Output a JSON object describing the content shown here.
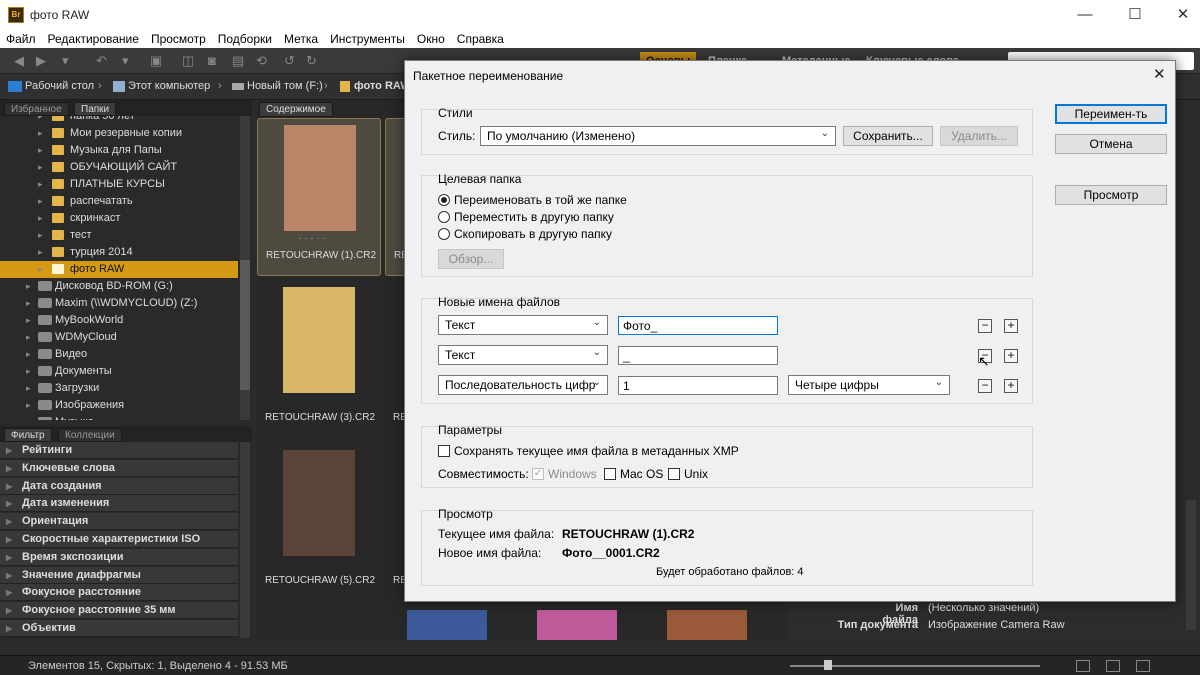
{
  "window": {
    "title": "фото RAW",
    "app_icon": "Br",
    "minimize": "—",
    "maximize": "☐",
    "close": "✕"
  },
  "menu": [
    "Файл",
    "Редактирование",
    "Просмотр",
    "Подборки",
    "Метка",
    "Инструменты",
    "Окно",
    "Справка"
  ],
  "path": [
    "Рабочий стол",
    "Этот компьютер",
    "Новый том (F:)",
    "фото RAW"
  ],
  "workspace_tabs": [
    "Основы",
    "Пленка",
    "Метаданные",
    "Ключевые слова"
  ],
  "left_panel": {
    "tabs": [
      "Избранное",
      "Папки"
    ],
    "folders": [
      {
        "label": "папка 50 лет",
        "type": "folder"
      },
      {
        "label": "Мои резервные копии",
        "type": "folder"
      },
      {
        "label": "Музыка для Папы",
        "type": "folder"
      },
      {
        "label": "ОБУЧАЮЩИЙ САЙТ",
        "type": "folder"
      },
      {
        "label": "ПЛАТНЫЕ КУРСЫ",
        "type": "folder"
      },
      {
        "label": "распечатать",
        "type": "folder"
      },
      {
        "label": "скринкаст",
        "type": "folder"
      },
      {
        "label": "тест",
        "type": "folder"
      },
      {
        "label": "турция 2014",
        "type": "folder"
      },
      {
        "label": "фото RAW",
        "type": "folder",
        "selected": true
      },
      {
        "label": "Дисковод BD-ROM (G:)",
        "type": "drive"
      },
      {
        "label": "Maxim (\\\\WDMYCLOUD) (Z:)",
        "type": "drive"
      },
      {
        "label": "MyBookWorld",
        "type": "drive"
      },
      {
        "label": "WDMyCloud",
        "type": "drive"
      },
      {
        "label": "Видео",
        "type": "drive"
      },
      {
        "label": "Документы",
        "type": "drive"
      },
      {
        "label": "Загрузки",
        "type": "drive"
      },
      {
        "label": "Изображения",
        "type": "drive"
      },
      {
        "label": "Музыка",
        "type": "drive"
      }
    ],
    "filter_tabs": [
      "Фильтр",
      "Коллекции"
    ],
    "filters": [
      "Рейтинги",
      "Ключевые слова",
      "Дата создания",
      "Дата изменения",
      "Ориентация",
      "Скоростные характеристики ISO",
      "Время экспозиции",
      "Значение диафрагмы",
      "Фокусное расстояние",
      "Фокусное расстояние 35 мм",
      "Объектив"
    ]
  },
  "content": {
    "tab": "Содержимое",
    "thumbnails": [
      {
        "caption": "RETOUCHRAW (1).CR2",
        "selected": true,
        "color": "#b98468"
      },
      {
        "caption": "RE",
        "selected": true,
        "color": "#555"
      },
      {
        "caption": "RETOUCHRAW (3).CR2",
        "selected": false,
        "color": "#d8b66a"
      },
      {
        "caption": "RE",
        "selected": false,
        "color": "#555"
      },
      {
        "caption": "RETOUCHRAW (5).CR2",
        "selected": false,
        "color": "#5a4438"
      },
      {
        "caption": "RE",
        "selected": false,
        "color": "#555"
      }
    ],
    "rating_dots": "· · · · ·"
  },
  "right_panel": {
    "meta": [
      {
        "key": "Имя файла",
        "value": "(Несколько значений)"
      },
      {
        "key": "Тип документа",
        "value": "Изображение Camera Raw"
      }
    ]
  },
  "status": {
    "text": "Элементов 15, Скрытых: 1, Выделено 4 - 91.53 МБ"
  },
  "dialog": {
    "title": "Пакетное переименование",
    "close": "✕",
    "buttons": {
      "rename": "Переимен-ть",
      "cancel": "Отмена",
      "preview": "Просмотр"
    },
    "styles": {
      "group_title": "Стили",
      "label": "Стиль:",
      "value": "По умолчанию (Изменено)",
      "save": "Сохранить...",
      "delete": "Удалить..."
    },
    "target": {
      "group_title": "Целевая папка",
      "options": [
        {
          "label": "Переименовать в той же папке",
          "checked": true
        },
        {
          "label": "Переместить в другую папку",
          "checked": false
        },
        {
          "label": "Скопировать в другую папку",
          "checked": false
        }
      ],
      "browse": "Обзор..."
    },
    "new_names": {
      "group_title": "Новые имена файлов",
      "rows": [
        {
          "type": "Текст",
          "value": "Фото_",
          "extra": ""
        },
        {
          "type": "Текст",
          "value": "_",
          "extra": ""
        },
        {
          "type": "Последовательность цифр",
          "value": "1",
          "extra": "Четыре цифры"
        }
      ],
      "minus": "−",
      "plus": "+"
    },
    "params": {
      "group_title": "Параметры",
      "keep_name": "Сохранять текущее имя файла в метаданных XMP",
      "compat_label": "Совместимость:",
      "compat": [
        {
          "label": "Windows",
          "checked": true,
          "disabled": true
        },
        {
          "label": "Mac OS",
          "checked": false,
          "disabled": false
        },
        {
          "label": "Unix",
          "checked": false,
          "disabled": false
        }
      ]
    },
    "preview": {
      "group_title": "Просмотр",
      "current_label": "Текущее имя файла:",
      "current_value": "RETOUCHRAW (1).CR2",
      "new_label": "Новое имя файла:",
      "new_value": "Фото__0001.CR2",
      "count": "Будет обработано файлов: 4"
    }
  }
}
